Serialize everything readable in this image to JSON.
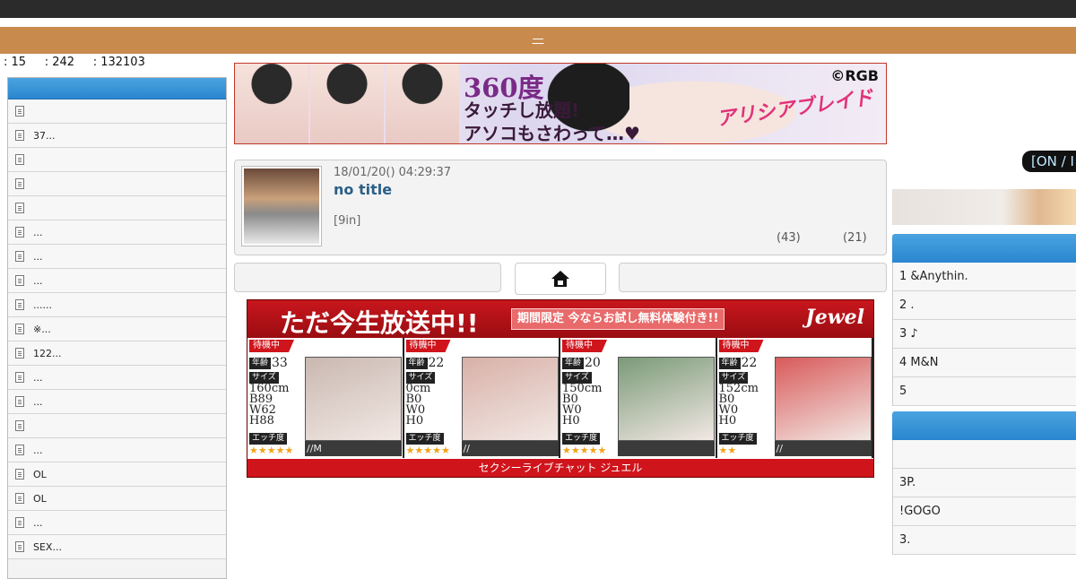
{
  "site": {
    "title": "—"
  },
  "stats": {
    "text": ": 15     : 242     : 132103"
  },
  "sidebar": {
    "items": [
      {
        "label": ""
      },
      {
        "label": "37..."
      },
      {
        "label": ""
      },
      {
        "label": ""
      },
      {
        "label": ""
      },
      {
        "label": "..."
      },
      {
        "label": "..."
      },
      {
        "label": "..."
      },
      {
        "label": "......"
      },
      {
        "label": "※..."
      },
      {
        "label": "122..."
      },
      {
        "label": "..."
      },
      {
        "label": "..."
      },
      {
        "label": ""
      },
      {
        "label": "..."
      },
      {
        "label": "OL"
      },
      {
        "label": "OL"
      },
      {
        "label": "..."
      },
      {
        "label": "SEX..."
      }
    ]
  },
  "banner": {
    "headline": "360度",
    "line2": "タッチし放題!",
    "line3": "アソコもさわって…♥",
    "copyright": "©RGB",
    "logo": "アリシアブレイド"
  },
  "post": {
    "date": "18/01/20() 04:29:37",
    "title": "no title",
    "meta": "[9in]",
    "count1": "(43)",
    "count2": "(21)"
  },
  "live_ad": {
    "headline": "ただ今生放送中!!",
    "sub": "期間限定 今ならお試し無料体験付き!!",
    "brand": "Jewel",
    "footer": "セクシーライブチャット ジュエル",
    "status_label": "待機中",
    "age_label": "年齢",
    "size_label": "サイズ",
    "ecchi_label": "エッチ度",
    "performers": [
      {
        "age": "33",
        "spec": "160cm\nB89\nW62\nH88",
        "stars": "★★★★★",
        "caption": "//M",
        "photo_color": "#c9b8b0"
      },
      {
        "age": "22",
        "spec": "0cm\nB0\nW0\nH0",
        "stars": "★★★★★",
        "caption": "//",
        "photo_color": "#d8b0a8"
      },
      {
        "age": "20",
        "spec": "150cm\nB0\nW0\nH0",
        "stars": "★★★★★",
        "caption": "",
        "photo_color": "#7a9a78"
      },
      {
        "age": "22",
        "spec": "152cm\nB0\nW0\nH0",
        "stars": "★★",
        "caption": "//",
        "photo_color": "#d85a5a"
      }
    ]
  },
  "right": {
    "badge": "[ON / I",
    "list1": [
      {
        "label": "1 &Anythin."
      },
      {
        "label": "2 ."
      },
      {
        "label": "3 ♪"
      },
      {
        "label": "4 M&N"
      },
      {
        "label": "5"
      }
    ],
    "list2": [
      {
        "label": ""
      },
      {
        "label": "3P."
      },
      {
        "label": "!GOGO"
      },
      {
        "label": "3."
      }
    ]
  }
}
